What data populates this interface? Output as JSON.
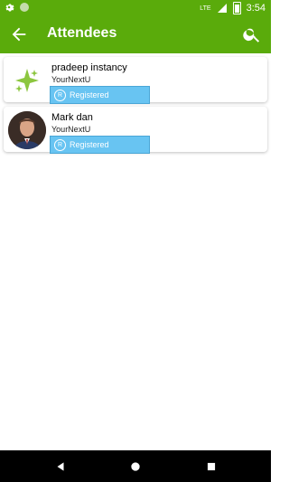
{
  "status_bar": {
    "time": "3:54",
    "network": "LTE"
  },
  "app_bar": {
    "title": "Attendees",
    "back_icon": "arrow-back-icon",
    "search_icon": "search-icon"
  },
  "attendees": [
    {
      "name": "pradeep instancy",
      "org": "YourNextU",
      "status": "Registered",
      "avatar": "star-logo"
    },
    {
      "name": "Mark dan",
      "org": "YourNextU",
      "status": "Registered",
      "avatar": "person-photo"
    }
  ],
  "colors": {
    "primary": "#5aab0b",
    "badge": "#68c4f2"
  }
}
